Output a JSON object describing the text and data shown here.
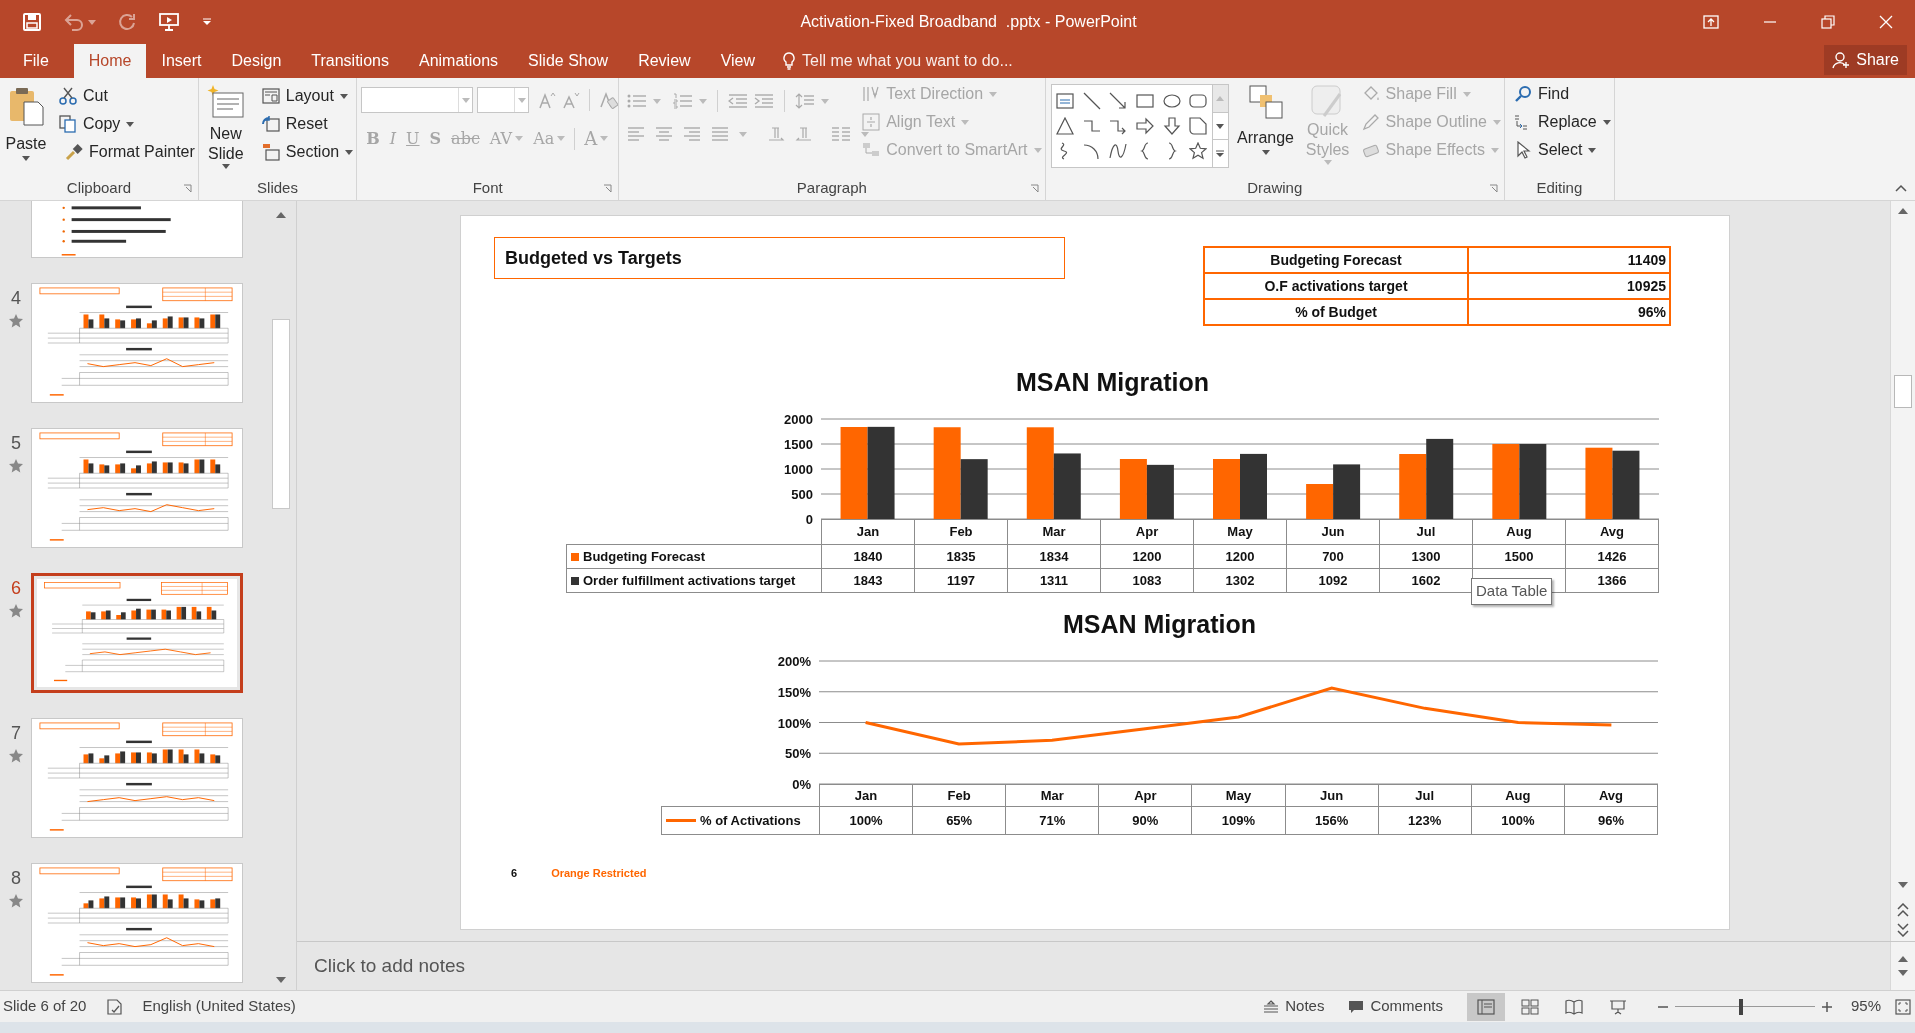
{
  "window": {
    "title": "Activation-Fixed Broadband  .pptx - PowerPoint"
  },
  "ribbon_tabs": [
    {
      "label": "File",
      "selected": false
    },
    {
      "label": "Home",
      "selected": true
    },
    {
      "label": "Insert",
      "selected": false
    },
    {
      "label": "Design",
      "selected": false
    },
    {
      "label": "Transitions",
      "selected": false
    },
    {
      "label": "Animations",
      "selected": false
    },
    {
      "label": "Slide Show",
      "selected": false
    },
    {
      "label": "Review",
      "selected": false
    },
    {
      "label": "View",
      "selected": false
    }
  ],
  "tell_me": {
    "placeholder": "Tell me what you want to do..."
  },
  "share": {
    "label": "Share"
  },
  "ribbon": {
    "groups": [
      {
        "label": "Clipboard",
        "commands": [
          {
            "label": "Paste",
            "disabled": false
          },
          {
            "label": "Cut",
            "disabled": false
          },
          {
            "label": "Copy",
            "disabled": false
          },
          {
            "label": "Format Painter",
            "disabled": false
          }
        ]
      },
      {
        "label": "Slides",
        "commands": [
          {
            "label": "New Slide",
            "disabled": false
          },
          {
            "label": "Layout",
            "disabled": false
          },
          {
            "label": "Reset",
            "disabled": false
          },
          {
            "label": "Section",
            "disabled": false
          }
        ]
      },
      {
        "label": "Font",
        "commands": [
          {
            "label": "B",
            "disabled": true
          },
          {
            "label": "I",
            "disabled": true
          },
          {
            "label": "U",
            "disabled": true
          },
          {
            "label": "S",
            "disabled": true
          },
          {
            "label": "abc",
            "disabled": true
          },
          {
            "label": "AV",
            "disabled": true
          },
          {
            "label": "Aa",
            "disabled": true
          },
          {
            "label": "A",
            "disabled": true
          }
        ]
      },
      {
        "label": "Paragraph",
        "commands": [
          {
            "label": "Text Direction",
            "disabled": true
          },
          {
            "label": "Align Text",
            "disabled": true
          },
          {
            "label": "Convert to SmartArt",
            "disabled": true
          }
        ]
      },
      {
        "label": "Drawing",
        "commands": [
          {
            "label": "Arrange",
            "disabled": false
          },
          {
            "label": "Quick Styles",
            "disabled": true
          },
          {
            "label": "Shape Fill",
            "disabled": true
          },
          {
            "label": "Shape Outline",
            "disabled": true
          },
          {
            "label": "Shape Effects",
            "disabled": true
          }
        ]
      },
      {
        "label": "Editing",
        "commands": [
          {
            "label": "Find",
            "disabled": false
          },
          {
            "label": "Replace",
            "disabled": false
          },
          {
            "label": "Select",
            "disabled": false
          }
        ]
      }
    ]
  },
  "thumbnails": [
    {
      "kind": "bullets",
      "selected": false
    },
    {
      "number": "4",
      "kind": "charts",
      "selected": false
    },
    {
      "number": "5",
      "kind": "charts",
      "selected": false
    },
    {
      "number": "6",
      "kind": "charts",
      "selected": true
    },
    {
      "number": "7",
      "kind": "charts",
      "selected": false
    },
    {
      "number": "8",
      "kind": "charts",
      "selected": false
    }
  ],
  "slide": {
    "title": "Budgeted vs Targets",
    "summary_table": [
      {
        "label": "Budgeting Forecast",
        "value": "11409"
      },
      {
        "label": "O.F activations target",
        "value": "10925"
      },
      {
        "label": "% of Budget",
        "value": "96%"
      }
    ],
    "charts": [
      {
        "chart_data": {
          "type": "bar",
          "title": "MSAN Migration",
          "categories": [
            "Jan",
            "Feb",
            "Mar",
            "Apr",
            "May",
            "Jun",
            "Jul",
            "Aug",
            "Avg"
          ],
          "series": [
            {
              "name": "Budgeting Forecast",
              "color": "#ff6600",
              "values": [
                1840,
                1835,
                1834,
                1200,
                1200,
                700,
                1300,
                1500,
                1426
              ]
            },
            {
              "name": "Order fulfillment activations target",
              "color": "#333333",
              "values": [
                1843,
                1197,
                1311,
                1083,
                1302,
                1092,
                1602,
                1500,
                1366
              ]
            }
          ],
          "ylim": [
            0,
            2000
          ],
          "yticks": [
            0,
            500,
            1000,
            1500,
            2000
          ],
          "grid": true,
          "legend": true
        },
        "data_table": [
          [
            {
              "text": "1840"
            },
            {
              "text": "1835"
            },
            {
              "text": "1834"
            },
            {
              "text": "1200"
            },
            {
              "text": "1200"
            },
            {
              "text": "700"
            },
            {
              "text": "1300"
            },
            {
              "text": "1500"
            },
            {
              "text": "1426"
            }
          ],
          [
            {
              "text": "1843"
            },
            {
              "text": "1197"
            },
            {
              "text": "1311"
            },
            {
              "text": "1083"
            },
            {
              "text": "1302"
            },
            {
              "text": "1092"
            },
            {
              "text": "1602"
            },
            {
              "covered": true
            },
            {
              "text": "1366"
            }
          ]
        ]
      },
      {
        "chart_data": {
          "type": "line",
          "title": "MSAN Migration",
          "categories": [
            "Jan",
            "Feb",
            "Mar",
            "Apr",
            "May",
            "Jun",
            "Jul",
            "Aug",
            "Avg"
          ],
          "series": [
            {
              "name": "% of Activations",
              "color": "#ff6600",
              "values": [
                100,
                65,
                71,
                90,
                109,
                156,
                123,
                100,
                96
              ]
            }
          ],
          "ylim": [
            0,
            200
          ],
          "yticks": [
            {
              "value": 0,
              "label": "0%"
            },
            {
              "value": 50,
              "label": "50%"
            },
            {
              "value": 100,
              "label": "100%"
            },
            {
              "value": 150,
              "label": "150%"
            },
            {
              "value": 200,
              "label": "200%"
            }
          ],
          "grid": true,
          "legend": true
        },
        "data_table": [
          [
            {
              "text": "100%"
            },
            {
              "text": "65%"
            },
            {
              "text": "71%"
            },
            {
              "text": "90%"
            },
            {
              "text": "109%"
            },
            {
              "text": "156%"
            },
            {
              "text": "123%"
            },
            {
              "text": "100%"
            },
            {
              "text": "96%"
            }
          ]
        ]
      }
    ],
    "footer": {
      "page_number": "6",
      "classification": "Orange Restricted"
    },
    "tooltip": "Data Table"
  },
  "notes": {
    "placeholder": "Click to add notes"
  },
  "status_bar": {
    "slide_info": "Slide 6 of 20",
    "language": "English (United States)",
    "notes": "Notes",
    "comments": "Comments",
    "views": [
      {
        "kind": "normal",
        "selected": true
      },
      {
        "kind": "sorter",
        "selected": false
      },
      {
        "kind": "reading",
        "selected": false
      },
      {
        "kind": "slideshow",
        "selected": false
      }
    ],
    "zoom": {
      "level": 0.47,
      "reading": "95%"
    }
  }
}
